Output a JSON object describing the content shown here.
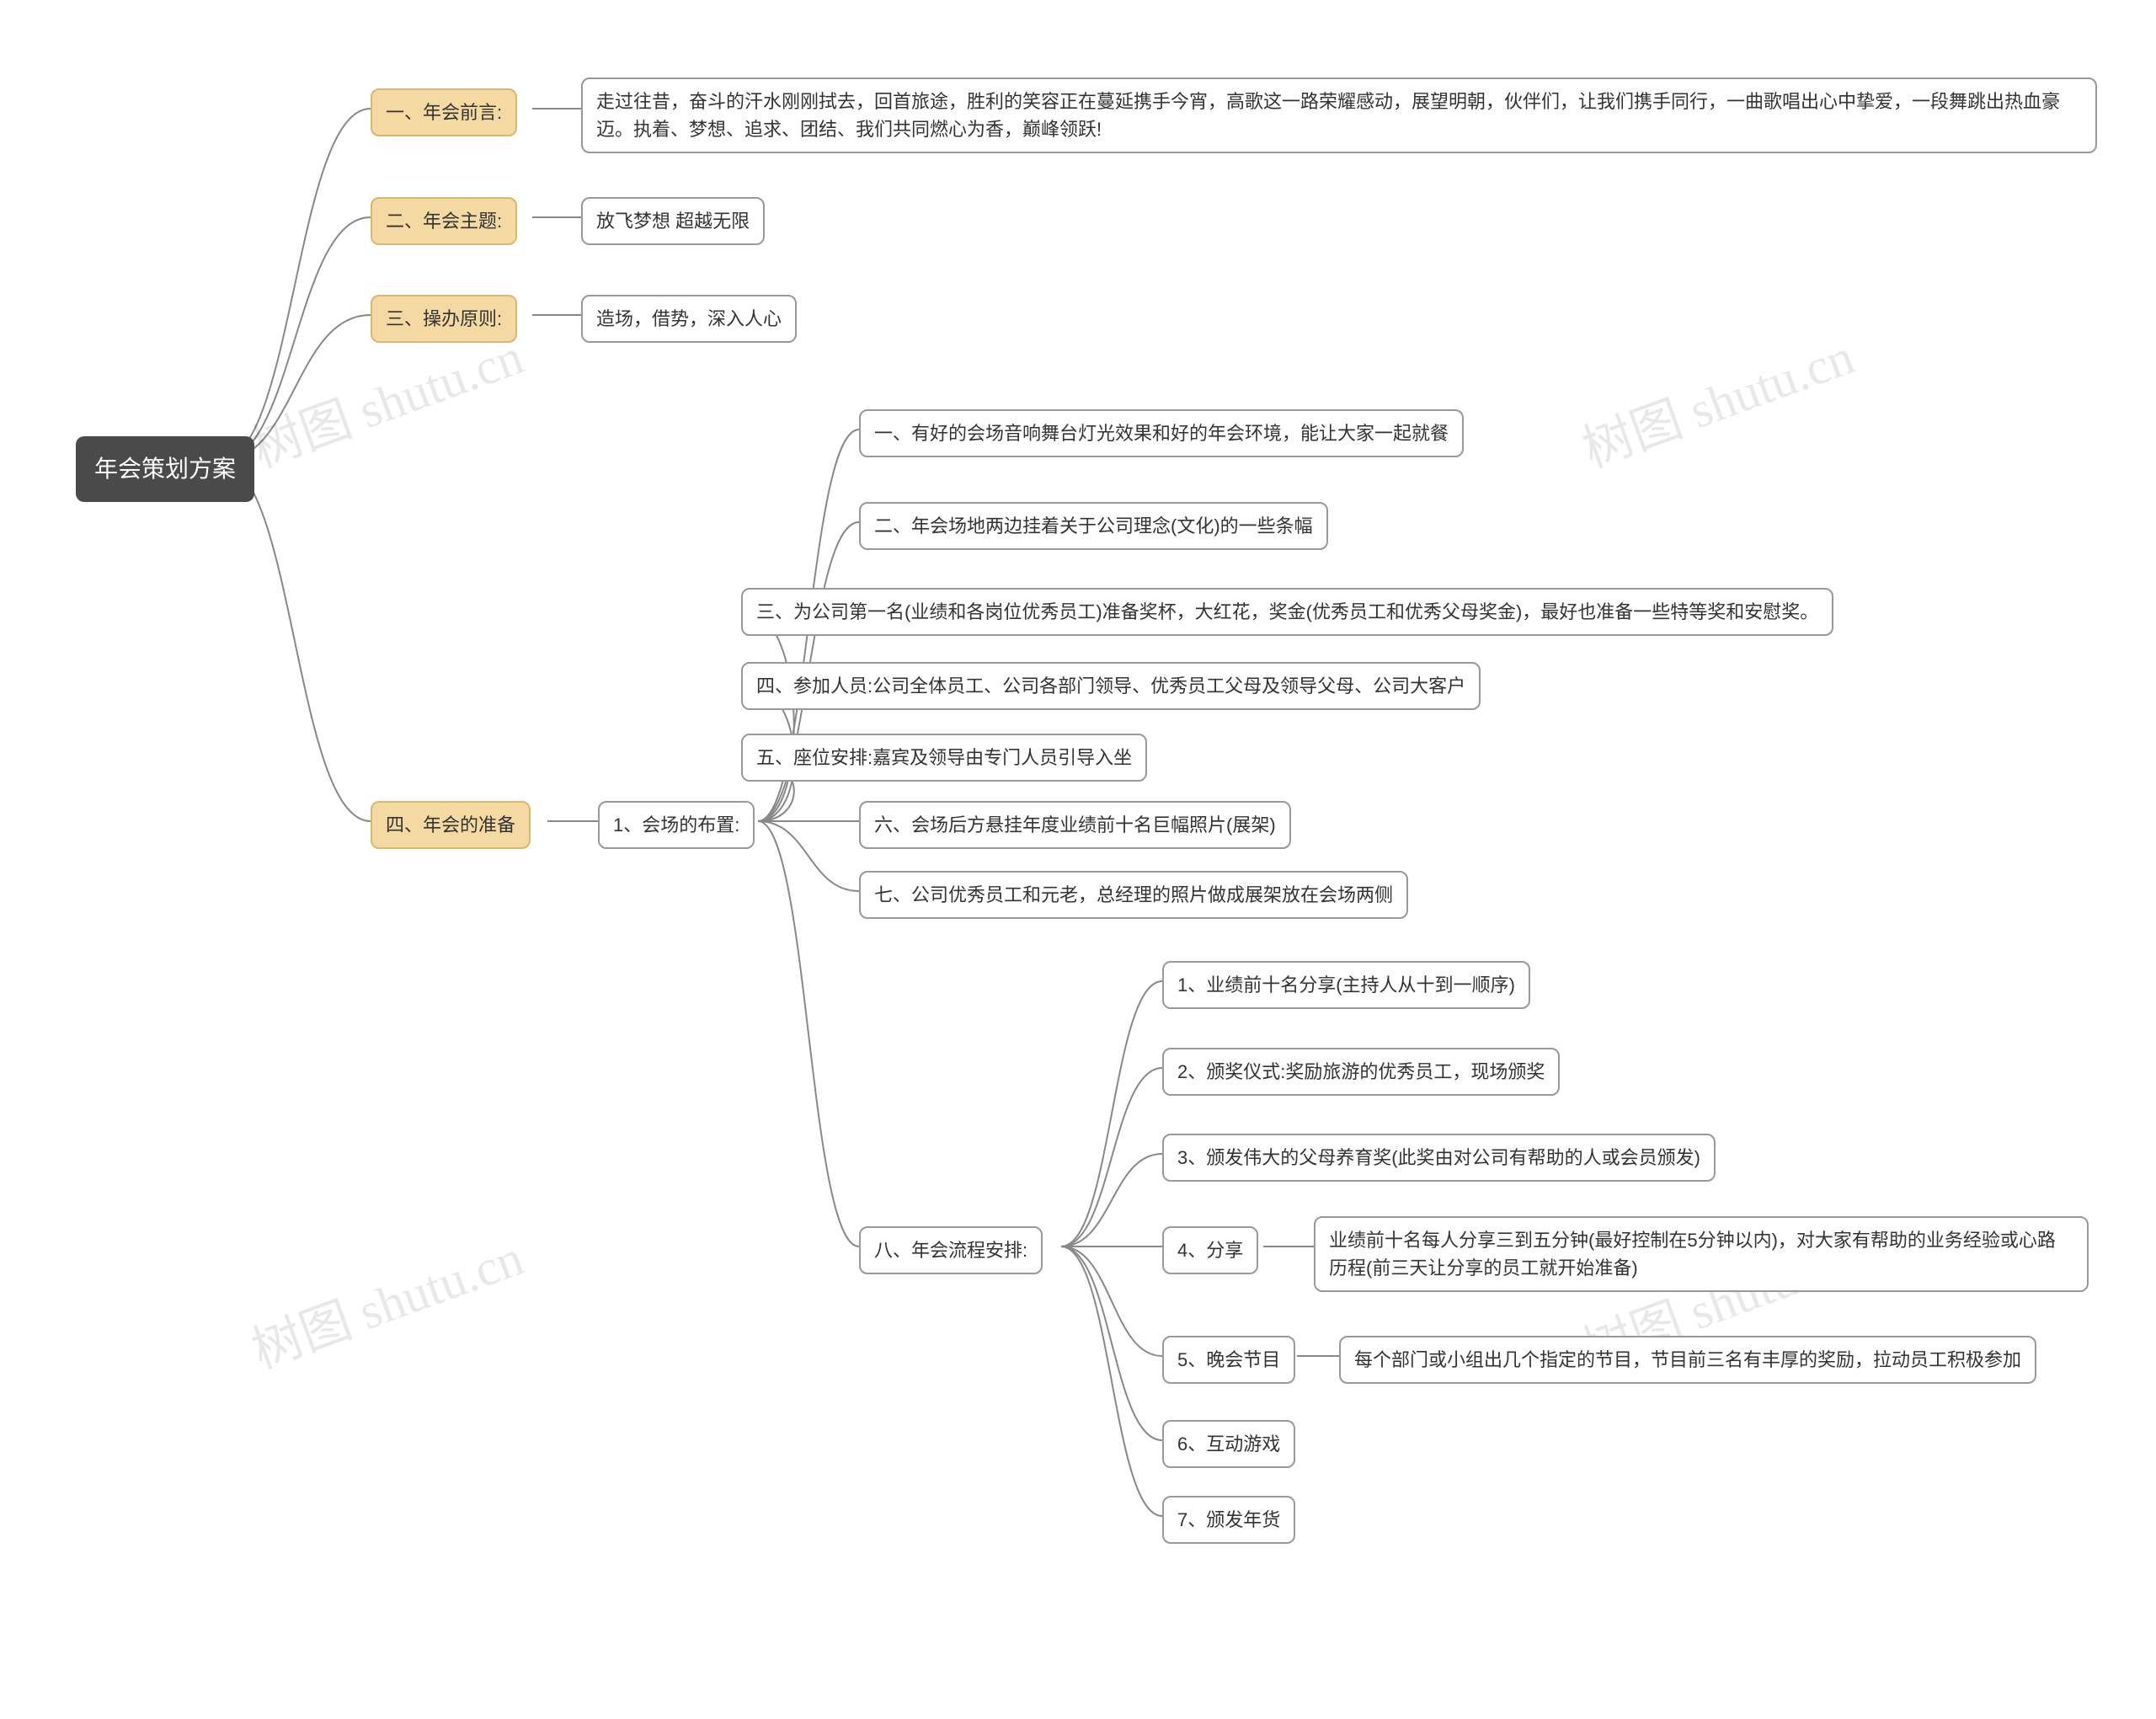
{
  "root": "年会策划方案",
  "watermark": "树图 shutu.cn",
  "branches": {
    "b1": {
      "label": "一、年会前言:",
      "content": "走过往昔，奋斗的汗水刚刚拭去，回首旅途，胜利的笑容正在蔓延携手今宵，高歌这一路荣耀感动，展望明朝，伙伴们，让我们携手同行，一曲歌唱出心中挚爱，一段舞跳出热血豪迈。执着、梦想、追求、团结、我们共同燃心为香，巅峰领跃!"
    },
    "b2": {
      "label": "二、年会主题:",
      "content": "放飞梦想 超越无限"
    },
    "b3": {
      "label": "三、操办原则:",
      "content": "造场，借势，深入人心"
    },
    "b4": {
      "label": "四、年会的准备",
      "sub": {
        "label": "1、会场的布置:",
        "items": {
          "i1": "一、有好的会场音响舞台灯光效果和好的年会环境，能让大家一起就餐",
          "i2": "二、年会场地两边挂着关于公司理念(文化)的一些条幅",
          "i3": "三、为公司第一名(业绩和各岗位优秀员工)准备奖杯，大红花，奖金(优秀员工和优秀父母奖金)，最好也准备一些特等奖和安慰奖。",
          "i4": "四、参加人员:公司全体员工、公司各部门领导、优秀员工父母及领导父母、公司大客户",
          "i5": "五、座位安排:嘉宾及领导由专门人员引导入坐",
          "i6": "六、会场后方悬挂年度业绩前十名巨幅照片(展架)",
          "i7": "七、公司优秀员工和元老，总经理的照片做成展架放在会场两侧",
          "i8": {
            "label": "八、年会流程安排:",
            "steps": {
              "s1": "1、业绩前十名分享(主持人从十到一顺序)",
              "s2": "2、颁奖仪式:奖励旅游的优秀员工，现场颁奖",
              "s3": "3、颁发伟大的父母养育奖(此奖由对公司有帮助的人或会员颁发)",
              "s4": {
                "label": "4、分享",
                "content": "业绩前十名每人分享三到五分钟(最好控制在5分钟以内)，对大家有帮助的业务经验或心路历程(前三天让分享的员工就开始准备)"
              },
              "s5": {
                "label": "5、晚会节目",
                "content": "每个部门或小组出几个指定的节目，节目前三名有丰厚的奖励，拉动员工积极参加"
              },
              "s6": "6、互动游戏",
              "s7": "7、颁发年货"
            }
          }
        }
      }
    }
  }
}
